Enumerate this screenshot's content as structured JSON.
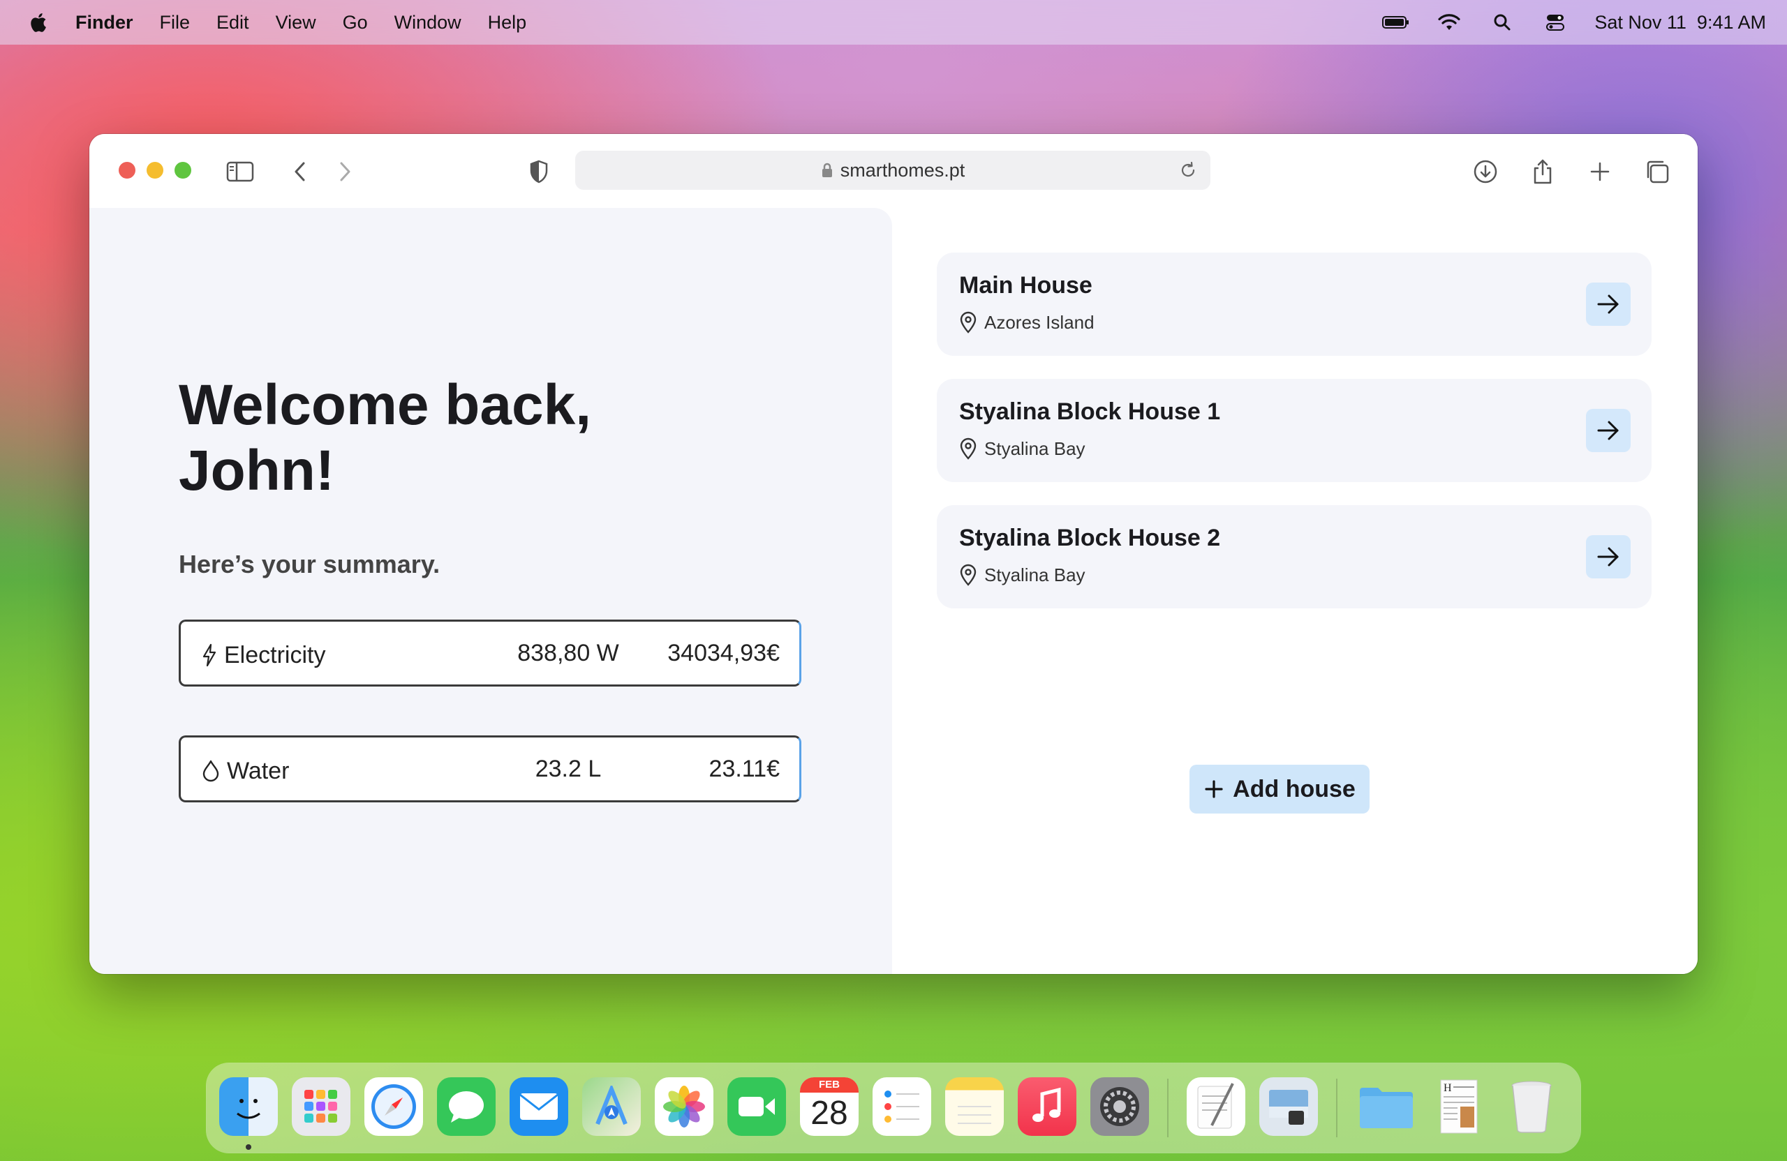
{
  "menubar": {
    "app_name": "Finder",
    "items": [
      "File",
      "Edit",
      "View",
      "Go",
      "Window",
      "Help"
    ],
    "datetime": "Sat Nov 11  9:41 AM",
    "icons": [
      "battery-icon",
      "wifi-icon",
      "spotlight-icon",
      "control-center-icon"
    ]
  },
  "browser": {
    "url": "smarthomes.pt"
  },
  "page": {
    "welcome_line1": "Welcome back,",
    "welcome_line2": "John!",
    "summary": "Here’s your summary.",
    "metrics": [
      {
        "label": "Electricity",
        "usage": "838,80 W",
        "cost": "34034,93€",
        "icon": "lightning-icon"
      },
      {
        "label": "Water",
        "usage": "23.2 L",
        "cost": "23.11€",
        "icon": "water-drop-icon"
      }
    ],
    "houses": [
      {
        "name": "Main House",
        "location": "Azores Island"
      },
      {
        "name": "Styalina Block House 1",
        "location": "Styalina Bay"
      },
      {
        "name": "Styalina Block House 2",
        "location": "Styalina Bay"
      }
    ],
    "add_house_label": "Add house"
  },
  "dock": {
    "apps": [
      "Finder",
      "Launchpad",
      "Safari",
      "Messages",
      "Mail",
      "Maps",
      "Photos",
      "FaceTime",
      "Calendar",
      "Reminders",
      "Notes",
      "Music",
      "System Settings",
      "TextEdit",
      "Preview",
      "Folder",
      "Document",
      "Trash"
    ],
    "calendar_month": "FEB",
    "calendar_day": "28"
  },
  "colors": {
    "accent_light_blue": "#d4e8fb",
    "metric_border_dark": "#3a3a3a",
    "metric_border_blue": "#5aa2e8",
    "pane_bg": "#f4f5fa"
  }
}
